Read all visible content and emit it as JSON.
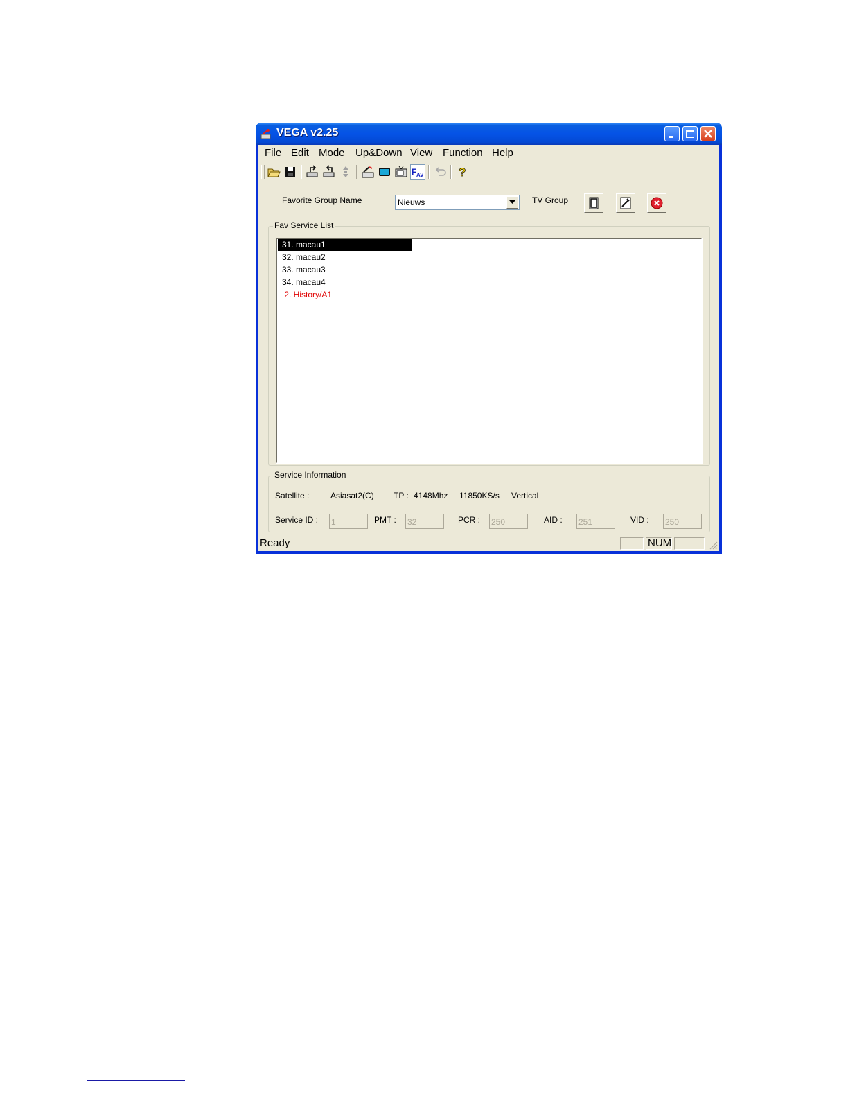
{
  "window": {
    "title": "VEGA v2.25",
    "caption_buttons": [
      "minimize-icon",
      "maximize-icon",
      "close-icon"
    ]
  },
  "menu": {
    "items": [
      {
        "accel": "F",
        "rest": "ile"
      },
      {
        "accel": "E",
        "rest": "dit"
      },
      {
        "accel": "M",
        "rest": "ode"
      },
      {
        "accel": "U",
        "rest": "p&Down"
      },
      {
        "accel": "V",
        "rest": "iew"
      },
      {
        "pre": "Fun",
        "accel": "c",
        "rest": "tion"
      },
      {
        "accel": "H",
        "rest": "elp"
      }
    ]
  },
  "toolbar": {
    "icons": [
      "open-folder-icon",
      "save-disk-icon",
      "upload-icon",
      "download-icon",
      "arrows-disabled-icon",
      "satellite-edit-icon",
      "tv-screen-icon",
      "tv-set-icon",
      "fav-icon",
      "undo-disabled-icon",
      "help-icon"
    ],
    "pressed": "fav-icon"
  },
  "favorite": {
    "label": "Favorite Group Name",
    "selected": "Nieuws",
    "tv_group_label": "TV Group",
    "buttons": [
      "new-group-icon",
      "rename-group-icon",
      "delete-group-icon"
    ]
  },
  "fav_list": {
    "title": "Fav Service List",
    "items": [
      {
        "text": "31. macau1",
        "selected": true,
        "color": "#000000"
      },
      {
        "text": "32. macau2",
        "selected": false,
        "color": "#000000"
      },
      {
        "text": "33. macau3",
        "selected": false,
        "color": "#000000"
      },
      {
        "text": "34. macau4",
        "selected": false,
        "color": "#000000"
      },
      {
        "text": " 2. History/A1",
        "selected": false,
        "color": "#e00000"
      }
    ]
  },
  "service_info": {
    "title": "Service Information",
    "satellite_label": "Satellite :",
    "satellite_value": "Asiasat2(C)",
    "tp_label": "TP :",
    "tp_freq": "4148Mhz",
    "symbol_rate": "11850KS/s",
    "polarization": "Vertical",
    "service_id_label": "Service ID :",
    "service_id": "1",
    "pmt_label": "PMT :",
    "pmt": "32",
    "pcr_label": "PCR :",
    "pcr": "250",
    "aid_label": "AID :",
    "aid": "251",
    "vid_label": "VID :",
    "vid": "250"
  },
  "status": {
    "text": "Ready",
    "num": "NUM"
  }
}
